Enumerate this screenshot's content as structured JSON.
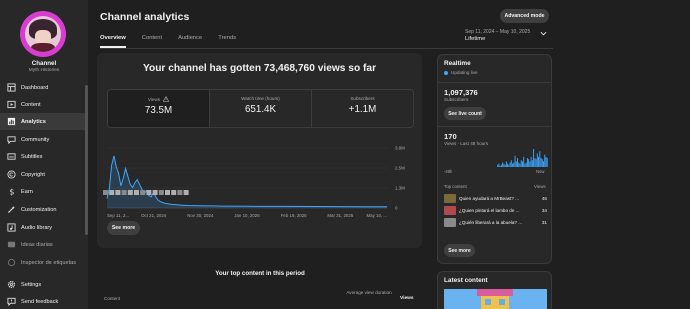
{
  "sidebar": {
    "channel_name": "Channel",
    "channel_handle": "Myth Histories",
    "items": [
      {
        "label": "Dashboard",
        "icon": "dashboard-icon"
      },
      {
        "label": "Content",
        "icon": "content-icon"
      },
      {
        "label": "Analytics",
        "icon": "analytics-icon",
        "active": true
      },
      {
        "label": "Community",
        "icon": "community-icon"
      },
      {
        "label": "Subtitles",
        "icon": "subtitles-icon"
      },
      {
        "label": "Copyright",
        "icon": "copyright-icon"
      },
      {
        "label": "Earn",
        "icon": "earn-icon"
      },
      {
        "label": "Customization",
        "icon": "customization-icon"
      },
      {
        "label": "Audio library",
        "icon": "audio-library-icon"
      },
      {
        "label": "Ideas diarias",
        "icon": "ideas-icon"
      },
      {
        "label": "Inspector de etiquetas",
        "icon": "tag-inspector-icon"
      },
      {
        "label": "Settings",
        "icon": "settings-icon"
      },
      {
        "label": "Send feedback",
        "icon": "feedback-icon"
      }
    ]
  },
  "header": {
    "title": "Channel analytics",
    "advanced_mode": "Advanced mode",
    "tabs": [
      "Overview",
      "Content",
      "Audience",
      "Trends"
    ],
    "date_range": "Sep 11, 2024 – May 10, 2025",
    "period": "Lifetime"
  },
  "overview": {
    "headline": "Your channel has gotten 73,468,760 views so far",
    "metrics": [
      {
        "label": "Views",
        "value": "73.5M"
      },
      {
        "label": "Watch time (hours)",
        "value": "651.4K"
      },
      {
        "label": "Subscribers",
        "value": "+1.1M"
      }
    ],
    "see_more": "See more"
  },
  "chart_data": {
    "type": "area",
    "x_ticks": [
      "Sep 11, 2...",
      "Oct 21, 2024",
      "Nov 30, 2024",
      "Jan 10, 2025",
      "Feb 19, 2025",
      "Mar 31, 2025",
      "May 10, ..."
    ],
    "y_ticks": [
      "3.8M",
      "2.5M",
      "1.3M",
      "0"
    ],
    "ylim": [
      0,
      3800000
    ],
    "x": [
      0,
      2,
      4,
      6,
      8,
      10,
      12,
      14,
      16,
      18,
      20,
      22,
      24,
      26,
      28,
      30,
      32,
      34,
      36,
      38,
      40,
      42,
      44,
      46,
      48,
      50,
      52,
      54,
      56,
      60,
      65,
      70,
      80,
      90,
      100,
      120,
      150,
      180,
      200,
      220,
      241
    ],
    "values": [
      600000,
      1200000,
      2700000,
      3300000,
      2600000,
      2200000,
      1400000,
      1900000,
      2500000,
      2000000,
      1500000,
      1300000,
      1600000,
      1800000,
      1500000,
      1200000,
      900000,
      1100000,
      800000,
      700000,
      1000000,
      700000,
      500000,
      400000,
      350000,
      300000,
      280000,
      250000,
      230000,
      200000,
      180000,
      160000,
      140000,
      130000,
      120000,
      110000,
      100000,
      95000,
      90000,
      85000,
      80000
    ],
    "grid": true
  },
  "top_content": {
    "title": "Your top content in this period",
    "col_content": "Content",
    "col_avg": "Average view duration",
    "col_views": "Views"
  },
  "realtime": {
    "title": "Realtime",
    "live_label": "Updating live",
    "subscribers": "1,097,376",
    "subscribers_label": "Subscribers",
    "see_live": "See live count",
    "views": "170",
    "views_label": "Views · Last 48 hours",
    "axis_left": "-48h",
    "axis_right": "Now",
    "bars": [
      0,
      0,
      0,
      0,
      0,
      0,
      0,
      0,
      0,
      0,
      0,
      0,
      0,
      0,
      0,
      0,
      0,
      0,
      0,
      0,
      0,
      0,
      0,
      0,
      0,
      0,
      0,
      0,
      0,
      0,
      0,
      0,
      0,
      0,
      0,
      0,
      0,
      0,
      0,
      0,
      0,
      0,
      0,
      2,
      3,
      1,
      2,
      4,
      3,
      2,
      5,
      3,
      2,
      4,
      6,
      3,
      4,
      10,
      5,
      8,
      4,
      3,
      6,
      5,
      9,
      3,
      4,
      8,
      7,
      5,
      9,
      6,
      16,
      8,
      7,
      12,
      9,
      14,
      8,
      7,
      5,
      11,
      9,
      8
    ],
    "top_content_label": "Top content",
    "views_header": "Views",
    "items": [
      {
        "title": "Quien ayudará a MrBeast? ...",
        "views": "46",
        "thumb": "#7a6a3a"
      },
      {
        "title": "¿Quien pintará el lambo de ...",
        "views": "34",
        "thumb": "#b04a4a"
      },
      {
        "title": "¿Quién liberará a la abuela? ...",
        "views": "31",
        "thumb": "#8a8a8a"
      }
    ],
    "see_more": "See more"
  },
  "latest": {
    "title": "Latest content"
  }
}
